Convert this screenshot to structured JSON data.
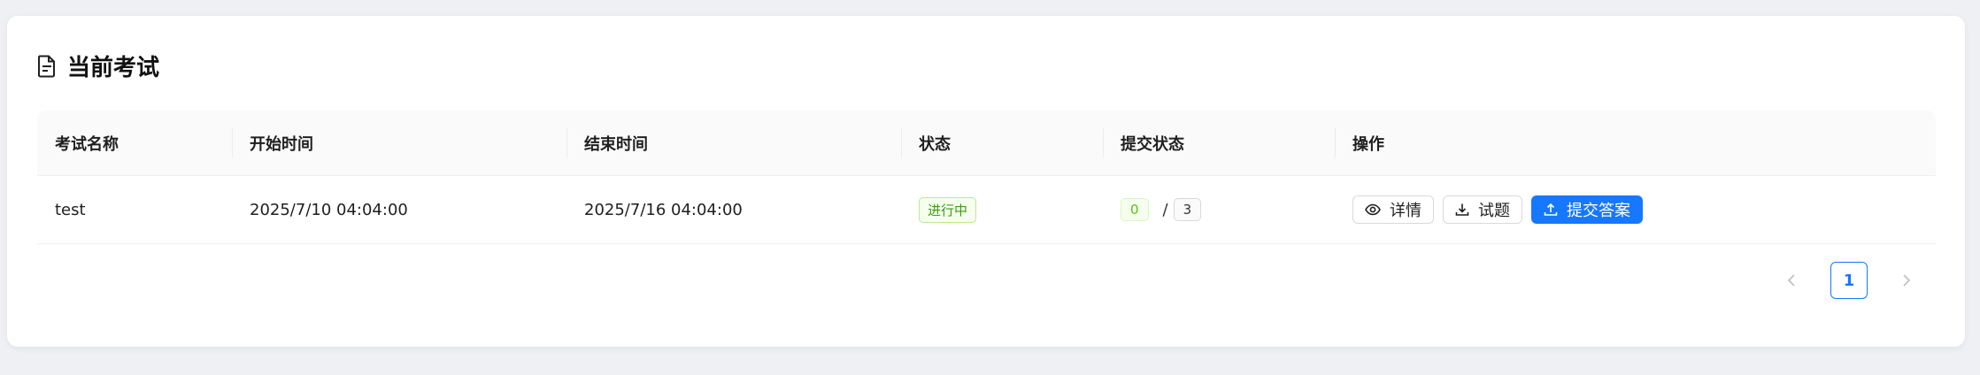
{
  "card": {
    "title": "当前考试",
    "title_icon": "file-text-icon"
  },
  "table": {
    "columns": [
      "考试名称",
      "开始时间",
      "结束时间",
      "状态",
      "提交状态",
      "操作"
    ],
    "rows": [
      {
        "name": "test",
        "start": "2025/7/10 04:04:00",
        "end": "2025/7/16 04:04:00",
        "status": "进行中",
        "submitted": "0",
        "separator": "/",
        "total": "3",
        "actions": {
          "detail": "详情",
          "download": "试题",
          "submit": "提交答案"
        }
      }
    ]
  },
  "pagination": {
    "current": "1",
    "prev_icon": "chevron-left-icon",
    "next_icon": "chevron-right-icon"
  },
  "colors": {
    "primary": "#1677ff",
    "success": "#52c41a",
    "background": "#eef0f4"
  }
}
